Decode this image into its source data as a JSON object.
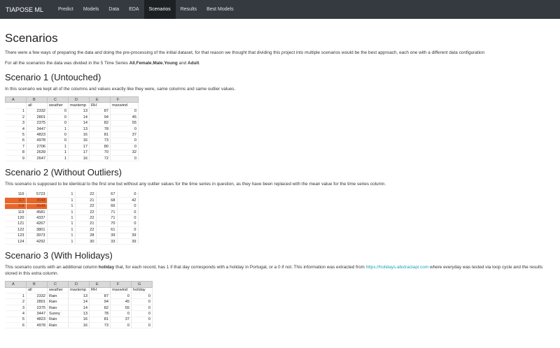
{
  "nav": {
    "brand": "TIAPOSE ML",
    "links": [
      "Predict",
      "Models",
      "Data",
      "EDA",
      "Scenarios",
      "Results",
      "Best Models"
    ]
  },
  "page": {
    "title": "Scenarios",
    "intro1": "There were a few ways of preparing the data and doing the pre-processing of the initial dataset, for that reason we thought that dividing this project into multiple scenarios would be the best approach, each one with a different data configuration",
    "intro2_prefix": "For all the scenarios the data was divided in the 5 Time Series ",
    "intro2_all": "All",
    "intro2_female": "Female",
    "intro2_male": "Male",
    "intro2_young": "Young",
    "intro2_and": " and ",
    "intro2_adult": "Adult"
  },
  "scenario1": {
    "title": "Scenario 1 (Untouched)",
    "desc": "In this scenario we kept all of the columns and values exactly like they were, same columns and same outlier values.",
    "letters": [
      "A",
      "B",
      "C",
      "D",
      "E",
      "F"
    ],
    "headers": [
      "",
      "all",
      "weather",
      "maxtemp",
      "RH",
      "maxwind"
    ],
    "rows": [
      [
        "1",
        "2332",
        "0",
        "13",
        "87",
        "0"
      ],
      [
        "2",
        "2801",
        "0",
        "14",
        "94",
        "45"
      ],
      [
        "3",
        "2375",
        "0",
        "14",
        "82",
        "55"
      ],
      [
        "4",
        "3447",
        "1",
        "13",
        "78",
        "0"
      ],
      [
        "5",
        "4823",
        "0",
        "16",
        "81",
        "37"
      ],
      [
        "6",
        "4978",
        "0",
        "16",
        "73",
        "0"
      ],
      [
        "7",
        "2706",
        "1",
        "17",
        "80",
        "0"
      ],
      [
        "8",
        "2639",
        "1",
        "17",
        "70",
        "32"
      ],
      [
        "9",
        "2647",
        "1",
        "16",
        "72",
        "0"
      ]
    ]
  },
  "scenario2": {
    "title": "Scenario 2 (Without Outliers)",
    "desc": "This scenario is supposed to be identical to the first one but without any outlier values for the time series in question, as they have been replaced with the mean value for the time series column.",
    "rows": [
      [
        "116",
        "5723",
        "1",
        "22",
        "67",
        "0"
      ],
      [
        "117",
        "3648",
        "1",
        "21",
        "68",
        "42"
      ],
      [
        "118",
        "3648",
        "1",
        "22",
        "66",
        "0"
      ],
      [
        "119",
        "4581",
        "1",
        "22",
        "71",
        "0"
      ],
      [
        "120",
        "4337",
        "1",
        "22",
        "71",
        "0"
      ],
      [
        "121",
        "4267",
        "1",
        "21",
        "70",
        "0"
      ],
      [
        "122",
        "3801",
        "1",
        "22",
        "61",
        "0"
      ],
      [
        "123",
        "3973",
        "1",
        "28",
        "39",
        "39"
      ],
      [
        "124",
        "4292",
        "1",
        "30",
        "33",
        "39"
      ]
    ],
    "highlight_color": "#e8662a"
  },
  "scenario3": {
    "title": "Scenario 3 (With Holidays)",
    "desc_prefix": "This scenario counts with an additional column ",
    "desc_bold": "holiday",
    "desc_mid": " that, for each record, has 1 if that day corresponds with a holiday in Portugal, or a 0 if not. This information was extracted from ",
    "desc_link": "https://holidays.abstractapi.com",
    "desc_suffix": " where everyday was tested via loop cycle and the results stored in this extra column.",
    "letters": [
      "A",
      "B",
      "C",
      "D",
      "E",
      "F",
      "G"
    ],
    "headers": [
      "",
      "all",
      "weather",
      "maxtemp",
      "RH",
      "maxwind",
      "holiday"
    ],
    "rows": [
      [
        "1",
        "2332",
        "Rain",
        "13",
        "87",
        "0",
        "0"
      ],
      [
        "2",
        "2801",
        "Rain",
        "14",
        "94",
        "45",
        "0"
      ],
      [
        "3",
        "2375",
        "Rain",
        "14",
        "82",
        "55",
        "0"
      ],
      [
        "4",
        "3447",
        "Sunny",
        "13",
        "78",
        "0",
        "0"
      ],
      [
        "5",
        "4823",
        "Rain",
        "16",
        "81",
        "37",
        "0"
      ],
      [
        "6",
        "4978",
        "Rain",
        "16",
        "73",
        "0",
        "0"
      ]
    ]
  }
}
